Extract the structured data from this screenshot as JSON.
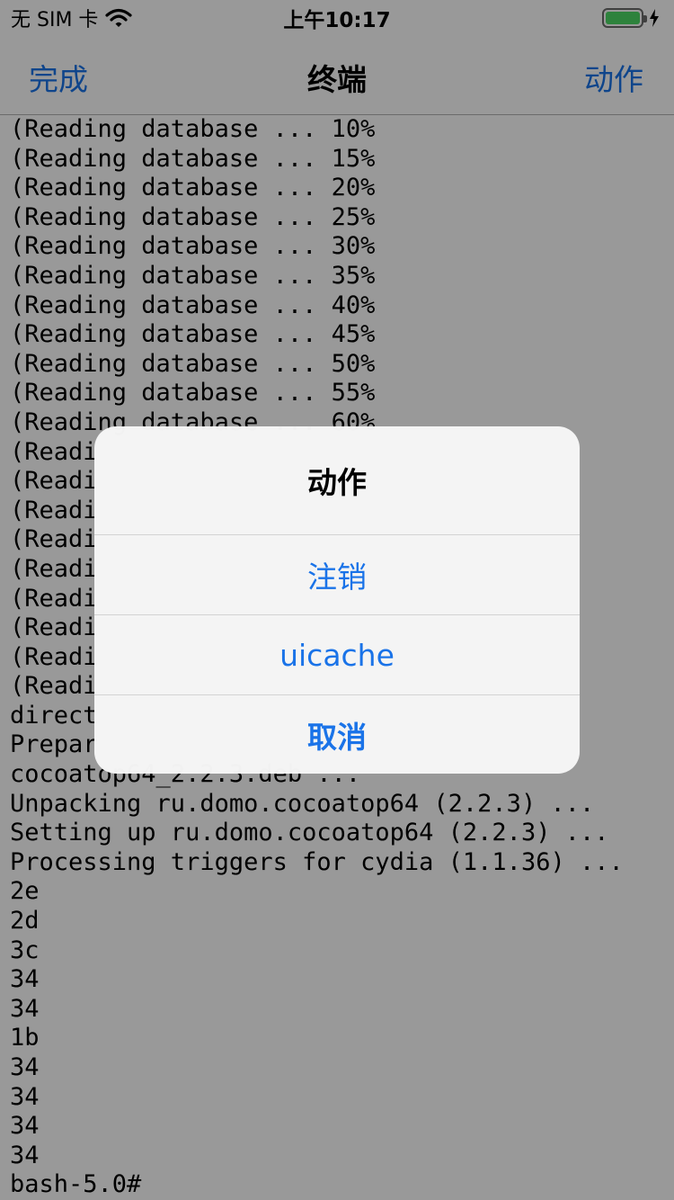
{
  "status_bar": {
    "carrier": "无 SIM 卡",
    "time": "上午10:17",
    "battery_level": 1.0,
    "battery_color": "#4cd964"
  },
  "nav": {
    "left_label": "完成",
    "title": "终端",
    "right_label": "动作"
  },
  "terminal": {
    "lines": [
      "(Reading database ... 10%",
      "(Reading database ... 15%",
      "(Reading database ... 20%",
      "(Reading database ... 25%",
      "(Reading database ... 30%",
      "(Reading database ... 35%",
      "(Reading database ... 40%",
      "(Reading database ... 45%",
      "(Reading database ... 50%",
      "(Reading database ... 55%",
      "(Reading database ... 60%",
      "(Readi",
      "(Readi",
      "(Readi",
      "(Readi",
      "(Readi",
      "(Readi",
      "(Readi",
      "(Readi",
      "(Readi",
      "direct",
      "Prepar",
      "cocoatop64_2.2.3.deb ...",
      "Unpacking ru.domo.cocoatop64 (2.2.3) ...",
      "Setting up ru.domo.cocoatop64 (2.2.3) ...",
      "Processing triggers for cydia (1.1.36) ...",
      "2e",
      "2d",
      "3c",
      "34",
      "34",
      "1b",
      "34",
      "34",
      "34",
      "34",
      "bash-5.0#"
    ]
  },
  "alert": {
    "title": "动作",
    "buttons": [
      {
        "label": "注销",
        "name": "logout-button"
      },
      {
        "label": "uicache",
        "name": "uicache-button"
      },
      {
        "label": "取消",
        "name": "cancel-button",
        "style": "cancel"
      }
    ]
  },
  "colors": {
    "accent": "#1a73e8",
    "overlay": "rgba(0,0,0,0.40)"
  },
  "icons": [
    "wifi-icon",
    "battery-icon",
    "charging-bolt-icon"
  ]
}
